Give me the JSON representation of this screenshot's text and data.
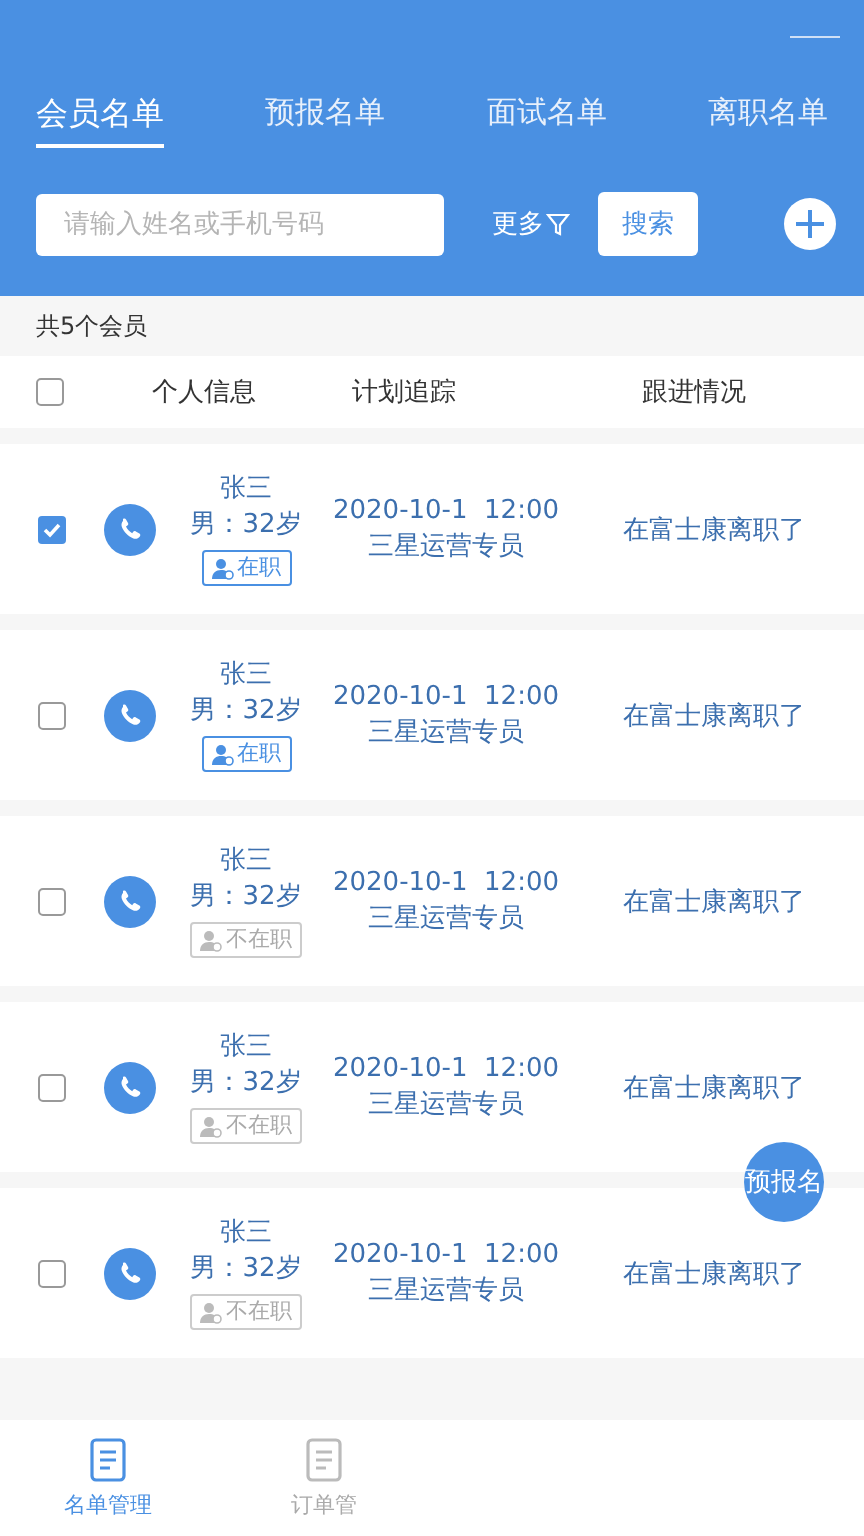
{
  "tabs": [
    {
      "label": "会员名单",
      "selected": true
    },
    {
      "label": "预报名单",
      "selected": false
    },
    {
      "label": "面试名单",
      "selected": false
    },
    {
      "label": "离职名单",
      "selected": false
    }
  ],
  "search": {
    "placeholder": "请输入姓名或手机号码",
    "more": "更多",
    "button": "搜索"
  },
  "count": "共5个会员",
  "columns": [
    "个人信息",
    "计划追踪",
    "跟进情况"
  ],
  "header_checked": false,
  "rows": [
    {
      "checked": true,
      "name": "张三",
      "info": "男：32岁",
      "status": "在职",
      "employed": true,
      "time": "2020-10-1  12:00",
      "position": "三星运营专员",
      "followup": "在富士康离职了"
    },
    {
      "checked": false,
      "name": "张三",
      "info": "男：32岁",
      "status": "在职",
      "employed": true,
      "time": "2020-10-1  12:00",
      "position": "三星运营专员",
      "followup": "在富士康离职了"
    },
    {
      "checked": false,
      "name": "张三",
      "info": "男：32岁",
      "status": "不在职",
      "employed": false,
      "time": "2020-10-1  12:00",
      "position": "三星运营专员",
      "followup": "在富士康离职了"
    },
    {
      "checked": false,
      "name": "张三",
      "info": "男：32岁",
      "status": "不在职",
      "employed": false,
      "time": "2020-10-1  12:00",
      "position": "三星运营专员",
      "followup": "在富士康离职了"
    },
    {
      "checked": false,
      "name": "张三",
      "info": "男：32岁",
      "status": "不在职",
      "employed": false,
      "time": "2020-10-1  12:00",
      "position": "三星运营专员",
      "followup": "在富士康离职了"
    }
  ],
  "float_button": "预报名",
  "bottom_nav": [
    {
      "label": "名单管理",
      "selected": true
    },
    {
      "label": "订单管",
      "selected": false
    }
  ]
}
